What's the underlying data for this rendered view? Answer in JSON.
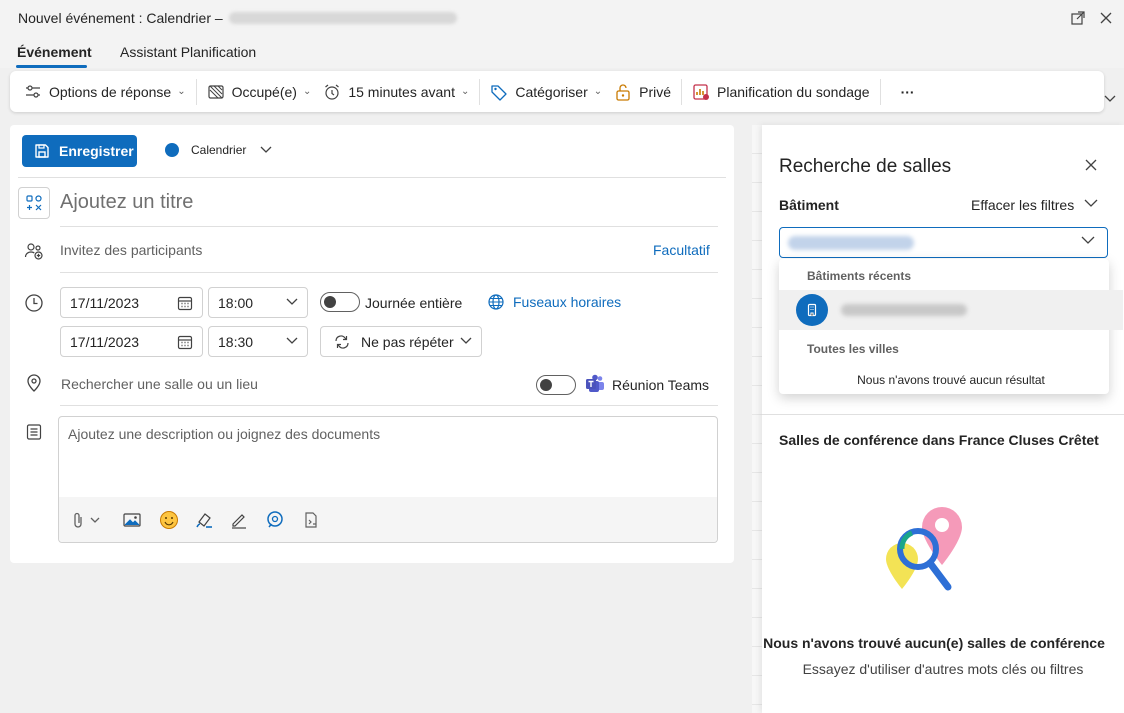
{
  "window": {
    "title": "Nouvel événement : Calendrier –"
  },
  "tabs": [
    {
      "label": "Événement",
      "active": true
    },
    {
      "label": "Assistant Planification",
      "active": false
    }
  ],
  "ribbon": {
    "response_options": "Options de réponse",
    "busy": "Occupé(e)",
    "reminder": "15 minutes avant",
    "categorize": "Catégoriser",
    "private": "Privé",
    "poll": "Planification du sondage",
    "more": "···"
  },
  "form": {
    "save_label": "Enregistrer",
    "calendar_label": "Calendrier",
    "calendar_color": "#0f6cbd",
    "title_placeholder": "Ajoutez un titre",
    "invite_placeholder": "Invitez des participants",
    "optional_label": "Facultatif",
    "start_date": "17/11/2023",
    "start_time": "18:00",
    "end_date": "17/11/2023",
    "end_time": "18:30",
    "all_day_label": "Journée entière",
    "timezones_label": "Fuseaux horaires",
    "repeat_label": "Ne pas répéter",
    "location_placeholder": "Rechercher une salle ou un lieu",
    "teams_label": "Réunion Teams",
    "description_placeholder": "Ajoutez une description ou joignez des documents"
  },
  "room_finder": {
    "title": "Recherche de salles",
    "building_label": "Bâtiment",
    "clear_filters": "Effacer les filtres",
    "dropdown": {
      "recent_header": "Bâtiments récents",
      "all_cities_header": "Toutes les villes",
      "no_result": "Nous n'avons trouvé aucun résultat"
    },
    "section_title": "Salles de conférence dans France Cluses Crêtet",
    "empty_title": "Nous n'avons trouvé aucun(e) salles de conférence",
    "empty_subtitle": "Essayez d'utiliser d'autres mots clés ou filtres"
  },
  "colors": {
    "accent": "#0f6cbd"
  }
}
